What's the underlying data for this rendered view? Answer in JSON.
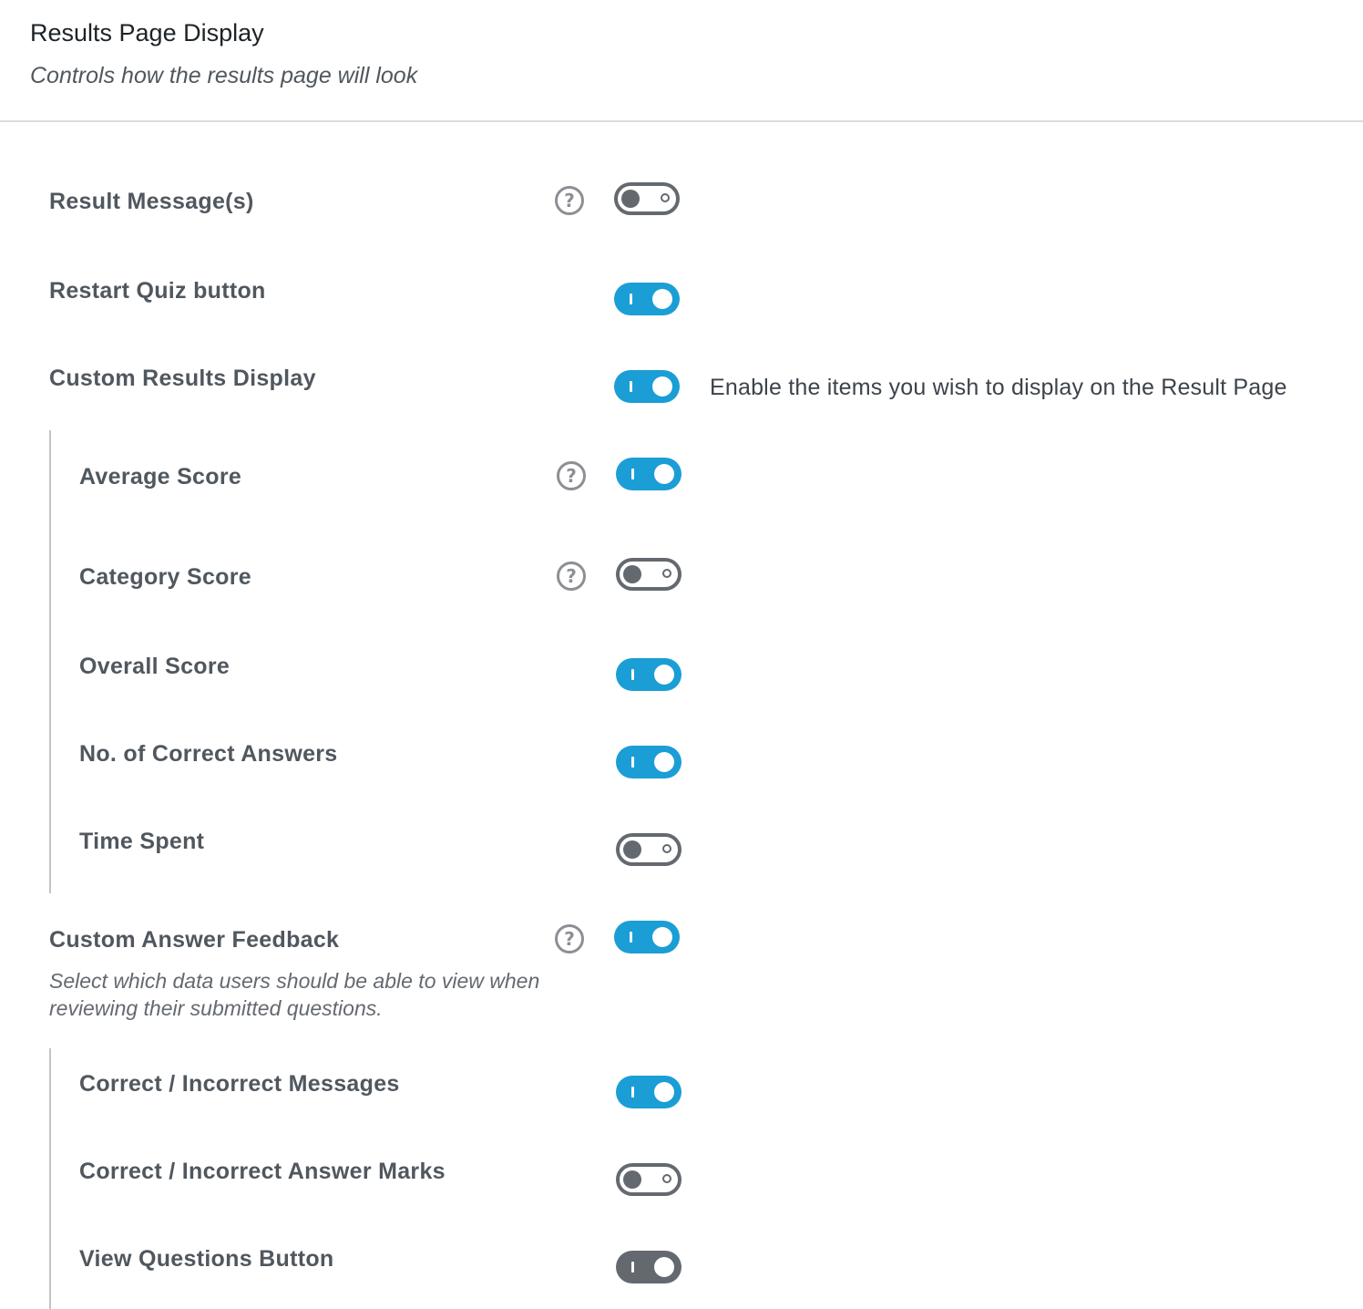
{
  "header": {
    "title": "Results Page Display",
    "subtitle": "Controls how the results page will look"
  },
  "rows": {
    "result_messages": {
      "label": "Result Message(s)",
      "enabled": false,
      "help": true
    },
    "restart_quiz": {
      "label": "Restart Quiz button",
      "enabled": true,
      "help": false
    },
    "custom_results_display": {
      "label": "Custom Results Display",
      "enabled": true,
      "help": false,
      "side_text": "Enable the items you wish to display on the Result Page"
    },
    "average_score": {
      "label": "Average Score",
      "enabled": true,
      "help": true
    },
    "category_score": {
      "label": "Category Score",
      "enabled": false,
      "help": true
    },
    "overall_score": {
      "label": "Overall Score",
      "enabled": true,
      "help": false
    },
    "correct_answers": {
      "label": "No. of Correct Answers",
      "enabled": true,
      "help": false
    },
    "time_spent": {
      "label": "Time Spent",
      "enabled": false,
      "help": false
    },
    "custom_answer_feedback": {
      "label": "Custom Answer Feedback",
      "description": "Select which data users should be able to view when reviewing their submitted questions.",
      "enabled": true,
      "help": true
    },
    "correct_incorrect_messages": {
      "label": "Correct / Incorrect Messages",
      "enabled": true,
      "help": false
    },
    "correct_incorrect_marks": {
      "label": "Correct / Incorrect Answer Marks",
      "enabled": false,
      "help": false
    },
    "view_questions_button": {
      "label": "View Questions Button",
      "enabled": true,
      "disabled": true,
      "help": false
    }
  },
  "icons": {
    "help": "help-circle-icon",
    "help_glyph": "?"
  },
  "colors": {
    "toggle_on": "#1a9ed5",
    "toggle_off": "#646970",
    "toggle_on_disabled": "#646970",
    "label_text": "#50575e",
    "help_icon": "#8c8f94"
  }
}
